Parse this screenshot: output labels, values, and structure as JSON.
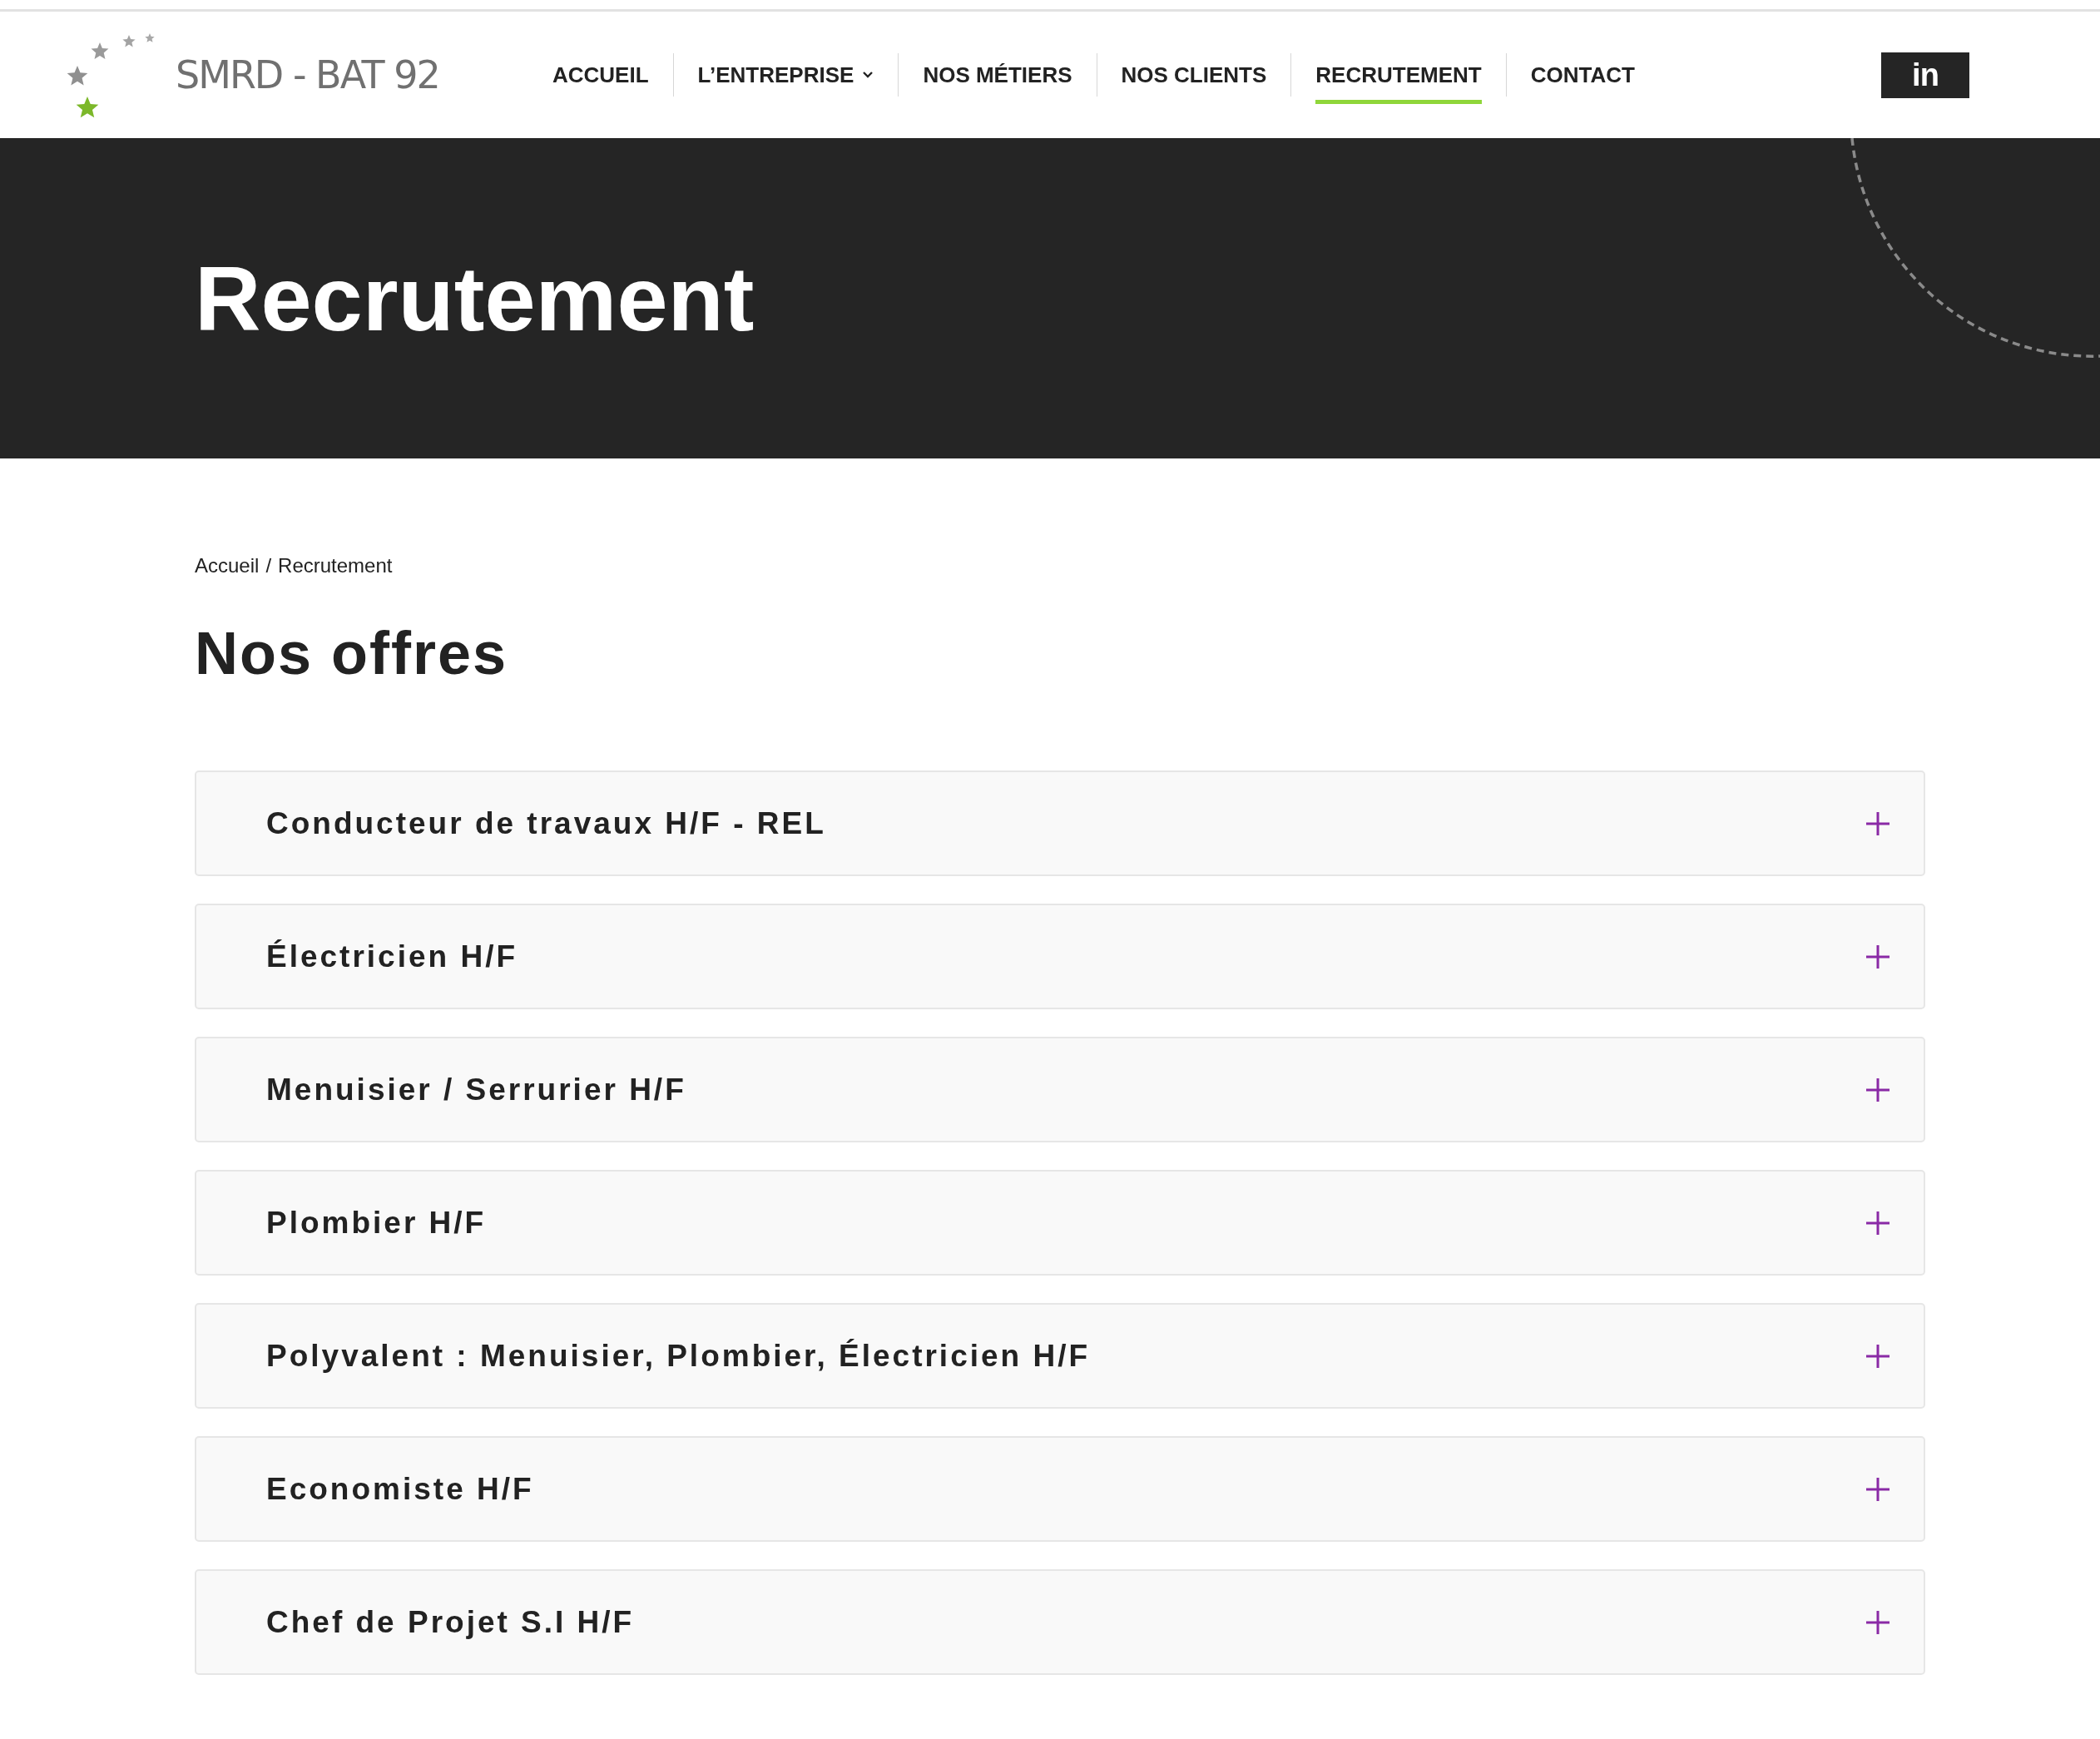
{
  "logo": {
    "text": "SMRD - BAT 92"
  },
  "nav": [
    {
      "label": "ACCUEIL",
      "selected": false,
      "dropdown": false
    },
    {
      "label": "L’ENTREPRISE",
      "selected": false,
      "dropdown": true
    },
    {
      "label": "NOS MÉTIERS",
      "selected": false,
      "dropdown": false
    },
    {
      "label": "NOS CLIENTS",
      "selected": false,
      "dropdown": false
    },
    {
      "label": "RECRUTEMENT",
      "selected": true,
      "dropdown": false
    },
    {
      "label": "CONTACT",
      "selected": false,
      "dropdown": false
    }
  ],
  "social": {
    "label": "in"
  },
  "hero": {
    "title": "Recrutement"
  },
  "breadcrumb": [
    "Accueil",
    "Recrutement"
  ],
  "breadcrumb_separator": "/",
  "section_title": "Nos offres",
  "offers": [
    {
      "title": "Conducteur de travaux H/F - REL",
      "expanded": false
    },
    {
      "title": "Électricien H/F",
      "expanded": false
    },
    {
      "title": "Menuisier / Serrurier H/F",
      "expanded": false
    },
    {
      "title": "Plombier H/F",
      "expanded": false
    },
    {
      "title": "Polyvalent : Menuisier, Plombier, Électricien H/F",
      "expanded": false
    },
    {
      "title": "Economiste H/F",
      "expanded": false
    },
    {
      "title": "Chef de Projet S.I H/F",
      "expanded": false
    }
  ]
}
